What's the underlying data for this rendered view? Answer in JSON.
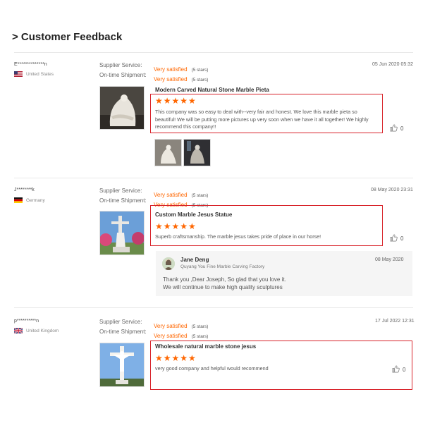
{
  "page": {
    "title": "> Customer Feedback"
  },
  "labels": {
    "supplier_service": "Supplier Service:",
    "ontime_shipment": "On-time Shipment:"
  },
  "reviews": [
    {
      "user": "E**************n",
      "country": "United States",
      "date": "05 Jun 2020 05:32",
      "supplier_service": "Very satisfied",
      "supplier_stars": "(5 stars)",
      "shipment": "Very satisfied",
      "shipment_stars": "(5 stars)",
      "product": "Modern Carved Natural Stone Marble Pieta",
      "rating": "★★★★★",
      "text": "This company was so easy to deal with--very fair and honest.  We love this marble pieta so beautiful!  We will be putting more pictures up very soon when we have it all together!  We highly recommend this company!!",
      "likes": "0"
    },
    {
      "user": "J********k",
      "country": "Germany",
      "date": "08 May 2020 23:31",
      "supplier_service": "Very satisfied",
      "supplier_stars": "(5 stars)",
      "shipment": "Very satisfied",
      "shipment_stars": "(5 stars)",
      "product": "Custom Marble Jesus Statue",
      "rating": "★★★★★",
      "text": "Superb craftsmanship. The marble jesus takes pride of place in our horse!",
      "likes": "0",
      "reply": {
        "name": "Jane Deng",
        "company": "Quyang You Fine Marble Carving Factory",
        "date": "08 May 2020",
        "line1": "Thank you ,Dear Joseph, So glad that you love it.",
        "line2": "We will continue to make high quality sculptures"
      }
    },
    {
      "user": "p**********n",
      "country": "United Kingdom",
      "date": "17 Jul 2022 12:31",
      "supplier_service": "Very satisfied",
      "supplier_stars": "(5 stars)",
      "shipment": "Very satisfied",
      "shipment_stars": "(5 stars)",
      "product": "Wholesale natural marble stone jesus",
      "rating": "★★★★★",
      "text": "very good company and helpful would recommend",
      "likes": "0"
    }
  ],
  "colors": {
    "accent": "#ff6600",
    "highlight_box": "#d8232a",
    "reply_bg": "#f5f5f5"
  },
  "icons": {
    "like": "thumbs-up-icon",
    "flags": [
      "us-flag-icon",
      "germany-flag-icon",
      "uk-flag-icon"
    ]
  }
}
